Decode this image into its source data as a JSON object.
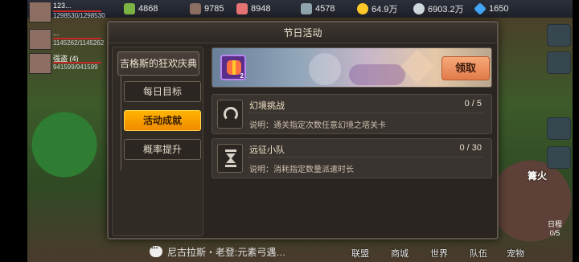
{
  "resources": [
    {
      "icon": "food-icon",
      "value": "4868"
    },
    {
      "icon": "wood-icon",
      "value": "9785"
    },
    {
      "icon": "stone-icon",
      "value": "8948"
    },
    {
      "icon": "iron-icon",
      "value": "4578"
    },
    {
      "icon": "gold-coin-icon",
      "value": "64.9万"
    },
    {
      "icon": "silver-coin-icon",
      "value": "6903.2万"
    },
    {
      "icon": "diamond-icon",
      "value": "1650"
    }
  ],
  "players": [
    {
      "name": "123...",
      "hp": "1298530/1298530"
    },
    {
      "name": "...",
      "hp": "1145262/1145262"
    },
    {
      "name": "强盗 (4)",
      "hp": "941599/941599"
    }
  ],
  "modal": {
    "title": "节日活动",
    "event_tab": "吉格斯的狂欢庆典",
    "sub_tabs": [
      "每日目标",
      "活动成就",
      "概率提升"
    ],
    "reward_qty": "2",
    "claim_label": "领取",
    "tasks": [
      {
        "title": "幻境挑战",
        "progress": "0 / 5",
        "desc": "说明：通关指定次数任意幻境之塔关卡"
      },
      {
        "title": "远征小队",
        "progress": "0 / 30",
        "desc": "说明：消耗指定数量派遣时长"
      }
    ]
  },
  "chat": {
    "text": "尼古拉斯・老登:元素弓遇…"
  },
  "nav": [
    "联盟",
    "商城",
    "世界",
    "队伍",
    "宠物"
  ],
  "side": {
    "daily_label": "日程",
    "daily_count": "0/5",
    "fire_label": "篝火"
  },
  "colors": {
    "active_tab": "#f5a000",
    "claim_button": "#ec8f5e",
    "modal_bg": "#2a2521"
  }
}
